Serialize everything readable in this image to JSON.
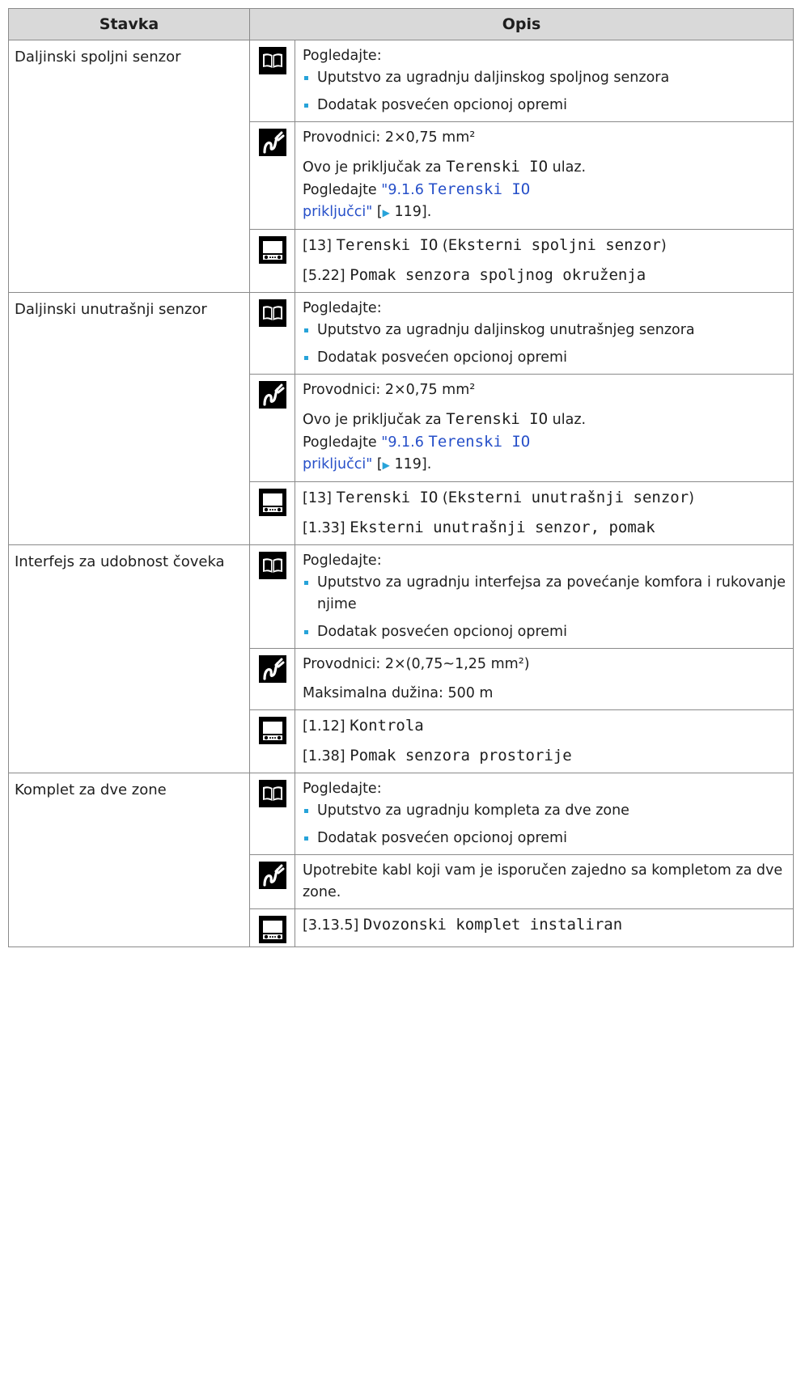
{
  "headers": {
    "item": "Stavka",
    "desc": "Opis"
  },
  "rows": [
    {
      "item": "Daljinski spoljni senzor",
      "book": {
        "intro": "Pogledajte:",
        "bullets": [
          "Uputstvo za ugradnju daljinskog spoljnog senzora",
          "Dodatak posvećen opcionoj opremi"
        ]
      },
      "wire": {
        "lines": [
          "Provodnici: 2×0,75 mm²"
        ],
        "conn_pre": "Ovo je priključak za ",
        "conn_mono": "Terenski IO",
        "conn_post": " ulaz.",
        "see": "Pogledajte ",
        "link_num": "\"9.1.6 ",
        "link_mono": "Terenski IO",
        "link_text": "priključci\"",
        "bracket_open": " [",
        "arrow": "▶",
        "page": " 119].",
        "has_conn": true
      },
      "ui": {
        "line1_code": "[13] ",
        "line1_mono": "Terenski IO",
        "line1_paren_open": " (",
        "line1_mono2": "Eksterni spoljni senzor",
        "line1_paren_close": ")",
        "line2_code": "[5.22] ",
        "line2_mono": "Pomak senzora spoljnog okruženja"
      }
    },
    {
      "item": "Daljinski unutrašnji senzor",
      "book": {
        "intro": "Pogledajte:",
        "bullets": [
          "Uputstvo za ugradnju daljinskog unutrašnjeg senzora",
          "Dodatak posvećen opcionoj opremi"
        ]
      },
      "wire": {
        "lines": [
          "Provodnici: 2×0,75 mm²"
        ],
        "conn_pre": "Ovo je priključak za ",
        "conn_mono": "Terenski IO",
        "conn_post": " ulaz.",
        "see": "Pogledajte ",
        "link_num": "\"9.1.6 ",
        "link_mono": "Terenski IO",
        "link_text": "priključci\"",
        "bracket_open": " [",
        "arrow": "▶",
        "page": " 119].",
        "has_conn": true
      },
      "ui": {
        "line1_code": "[13] ",
        "line1_mono": "Terenski IO",
        "line1_paren_open": " (",
        "line1_mono2": "Eksterni unutrašnji senzor",
        "line1_paren_close": ")",
        "line2_code": "[1.33] ",
        "line2_mono": "Eksterni unutrašnji senzor, pomak"
      }
    },
    {
      "item": "Interfejs za udobnost čoveka",
      "book": {
        "intro": "Pogledajte:",
        "bullets": [
          "Uputstvo za ugradnju interfejsa za povećanje komfora i rukovanje njime",
          "Dodatak posvećen opcionoj opremi"
        ]
      },
      "wire": {
        "lines": [
          "Provodnici: 2×(0,75~1,25 mm²)",
          "Maksimalna dužina: 500 m"
        ],
        "has_conn": false
      },
      "ui": {
        "line1_code": "[1.12] ",
        "line1_mono": "Kontrola",
        "line2_code": "[1.38] ",
        "line2_mono": "Pomak senzora prostorije"
      }
    },
    {
      "item": "Komplet za dve zone",
      "book": {
        "intro": "Pogledajte:",
        "bullets": [
          "Uputstvo za ugradnju kompleta za dve zone",
          "Dodatak posvećen opcionoj opremi"
        ]
      },
      "wire": {
        "lines": [
          "Upotrebite kabl koji vam je isporučen zajedno sa kompletom za dve zone."
        ],
        "has_conn": false
      },
      "ui": {
        "line1_code": "[3.13.5] ",
        "line1_mono": "Dvozonski komplet instaliran"
      }
    }
  ],
  "icons": {
    "book": "book-icon",
    "wire": "wiring-icon",
    "ui": "user-interface-icon"
  },
  "colors": {
    "bullet": "#27a3d9",
    "link": "#2750c9",
    "header_bg": "#d9d9d9"
  }
}
